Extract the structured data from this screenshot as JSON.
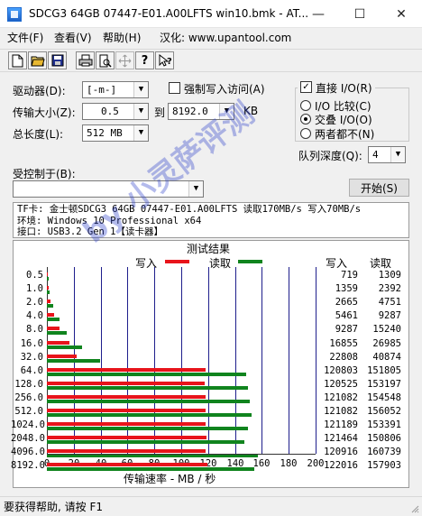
{
  "window": {
    "title": "SDCG3 64GB 07447-E01.A00LFTS win10.bmk - AT...",
    "minimize_glyph": "—",
    "maximize_glyph": "☐",
    "close_glyph": "✕"
  },
  "menu": {
    "file": "文件(F)",
    "view": "查看(V)",
    "help": "帮助(H)",
    "localize": "汉化: www.upantool.com"
  },
  "form": {
    "drive_label": "驱动器(D):",
    "drive_value": "[-m-]",
    "transfer_label": "传输大小(Z):",
    "transfer_from": "0.5",
    "to_label": "到",
    "transfer_to": "8192.0",
    "kb_label": "KB",
    "total_label": "总长度(L):",
    "total_value": "512 MB",
    "force_write_label": "强制写入访问(A)",
    "direct_io_label": "直接 I/O(R)",
    "io_compare_label": "I/O 比较(C)",
    "overlap_io_label": "交叠 I/O(O)",
    "neither_label": "两者都不(N)",
    "queue_label": "队列深度(Q):",
    "queue_value": "4",
    "controlled_label": "受控制于(B):",
    "controlled_value": "",
    "start_button": "开始(S)",
    "check_mark": "✓"
  },
  "info": {
    "line1": "TF卡: 金士顿SDCG3 64GB 07447-E01.A00LFTS 读取170MB/s 写入70MB/s",
    "line2": "环境: Windows 10 Professional x64",
    "line3": "接口: USB3.2 Gen 1【读卡器】"
  },
  "results": {
    "title": "测试结果",
    "write_label": "写入",
    "read_label": "读取",
    "xlabel": "传输速率 - MB / 秒",
    "colors": {
      "write": "#e8141b",
      "read": "#10841e"
    }
  },
  "chart_data": {
    "type": "bar",
    "title": "测试结果",
    "xlabel": "传输速率 - MB / 秒",
    "xlim": [
      0,
      200
    ],
    "x_ticks": [
      "0",
      "20",
      "40",
      "60",
      "80",
      "100",
      "120",
      "140",
      "160",
      "180",
      "200"
    ],
    "categories": [
      "0.5",
      "1.0",
      "2.0",
      "4.0",
      "8.0",
      "16.0",
      "32.0",
      "64.0",
      "128.0",
      "256.0",
      "512.0",
      "1024.0",
      "2048.0",
      "4096.0",
      "8192.0"
    ],
    "series": [
      {
        "name": "写入",
        "values": [
          0.7,
          1.3,
          2.6,
          5.3,
          9.1,
          16.5,
          22.3,
          118.0,
          117.7,
          118.2,
          118.2,
          118.3,
          118.6,
          118.1,
          119.4
        ],
        "raw": [
          "719",
          "1359",
          "2665",
          "5461",
          "9287",
          "16855",
          "22808",
          "120803",
          "120525",
          "121082",
          "121082",
          "121189",
          "121464",
          "120916",
          "122016"
        ]
      },
      {
        "name": "读取",
        "values": [
          1.3,
          2.3,
          4.6,
          9.1,
          14.9,
          26.4,
          39.9,
          148.3,
          149.6,
          150.9,
          152.4,
          149.8,
          147.3,
          157.0,
          154.2
        ],
        "raw": [
          "1309",
          "2392",
          "4751",
          "9287",
          "15240",
          "26985",
          "40874",
          "151805",
          "153197",
          "154548",
          "156052",
          "153391",
          "150806",
          "160739",
          "157903"
        ]
      }
    ]
  },
  "status": {
    "text": "要获得帮助, 请按 F1"
  },
  "watermark": "by 小灵萨评测"
}
